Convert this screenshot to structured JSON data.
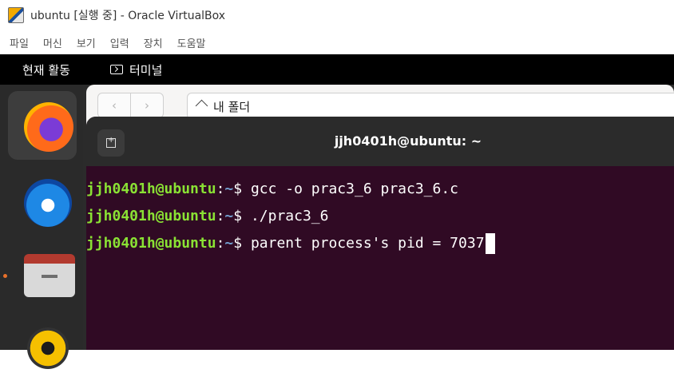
{
  "window": {
    "title": "ubuntu [실행 중] - Oracle VirtualBox",
    "menu": [
      "파일",
      "머신",
      "보기",
      "입력",
      "장치",
      "도움말"
    ]
  },
  "gnome_topbar": {
    "activities": "현재 활동",
    "app_name": "터미널"
  },
  "files_window": {
    "back": "‹",
    "forward": "›",
    "location": "내 폴더"
  },
  "terminal": {
    "title": "jjh0401h@ubuntu: ~",
    "prompt_user": "jjh0401h@ubuntu",
    "prompt_sep": ":",
    "prompt_path": "~",
    "prompt_symbol": "$ ",
    "lines": [
      {
        "command": "gcc -o prac3_6 prac3_6.c"
      },
      {
        "command": "./prac3_6"
      },
      {
        "command": "parent process's pid = 7037"
      }
    ]
  },
  "dock": {
    "apps": [
      "firefox-icon",
      "thunderbird-icon",
      "files-icon",
      "rhythmbox-icon"
    ],
    "running_indicator_color": "#e8702a"
  },
  "colors": {
    "terminal_bg": "#300a24",
    "prompt_user": "#8ae234",
    "prompt_path": "#729fcf"
  }
}
